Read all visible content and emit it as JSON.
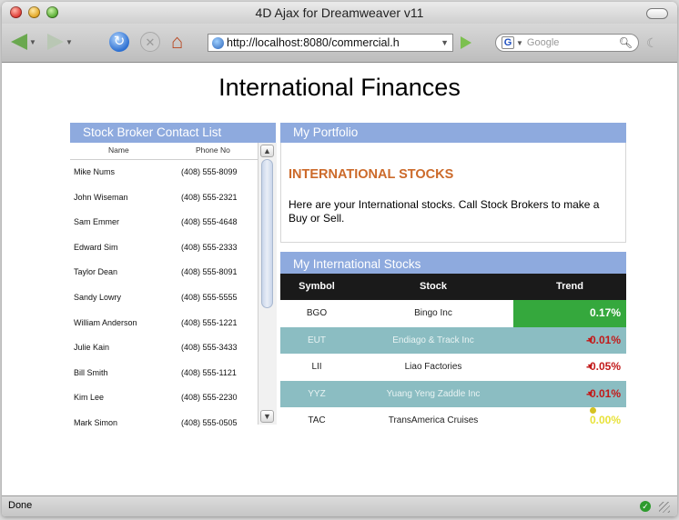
{
  "window": {
    "title": "4D Ajax for Dreamweaver v11"
  },
  "toolbar": {
    "url": "http://localhost:8080/commercial.h",
    "search_placeholder": "Google",
    "search_engine_letter": "G"
  },
  "page": {
    "title": "International Finances"
  },
  "contacts": {
    "header": "Stock Broker Contact List",
    "col_name": "Name",
    "col_phone": "Phone No",
    "rows": [
      {
        "name": "Mike Nums",
        "phone": "(408) 555-8099"
      },
      {
        "name": "John Wiseman",
        "phone": "(408) 555-2321"
      },
      {
        "name": "Sam Emmer",
        "phone": "(408) 555-4648"
      },
      {
        "name": "Edward Sim",
        "phone": "(408) 555-2333"
      },
      {
        "name": "Taylor Dean",
        "phone": "(408) 555-8091"
      },
      {
        "name": "Sandy Lowry",
        "phone": "(408) 555-5555"
      },
      {
        "name": "William Anderson",
        "phone": "(408) 555-1221"
      },
      {
        "name": "Julie Kain",
        "phone": "(408) 555-3433"
      },
      {
        "name": "Bill Smith",
        "phone": "(408) 555-1121"
      },
      {
        "name": "Kim Lee",
        "phone": "(408) 555-2230"
      },
      {
        "name": "Mark Simon",
        "phone": "(408) 555-0505"
      }
    ]
  },
  "portfolio": {
    "header": "My Portfolio",
    "title": "INTERNATIONAL STOCKS",
    "text": "Here are your International stocks. Call Stock Brokers to make a Buy or Sell."
  },
  "stocks": {
    "header": "My International Stocks",
    "col_symbol": "Symbol",
    "col_stock": "Stock",
    "col_trend": "Trend",
    "rows": [
      {
        "symbol": "BGO",
        "stock": "Bingo Inc",
        "trend": "0.17%",
        "direction": "up"
      },
      {
        "symbol": "EUT",
        "stock": "Endiago & Track Inc",
        "trend": "-0.01%",
        "direction": "down"
      },
      {
        "symbol": "LII",
        "stock": "Liao Factories",
        "trend": "-0.05%",
        "direction": "down"
      },
      {
        "symbol": "YYZ",
        "stock": "Yuang Yeng Zaddle Inc",
        "trend": "-0.01%",
        "direction": "down"
      },
      {
        "symbol": "TAC",
        "stock": "TransAmerica Cruises",
        "trend": "0.00%",
        "direction": "flat"
      }
    ]
  },
  "status": {
    "text": "Done"
  },
  "colors": {
    "panel_header": "#8eaade",
    "portfolio_title": "#cc6a2a",
    "up": "#35a83d",
    "down": "#c21a1a",
    "alt_row": "#8bbdc2"
  },
  "icons": [
    "back-icon",
    "forward-icon",
    "reload-icon",
    "stop-icon",
    "home-icon",
    "globe-icon",
    "go-icon",
    "search-icon",
    "ok-icon"
  ]
}
